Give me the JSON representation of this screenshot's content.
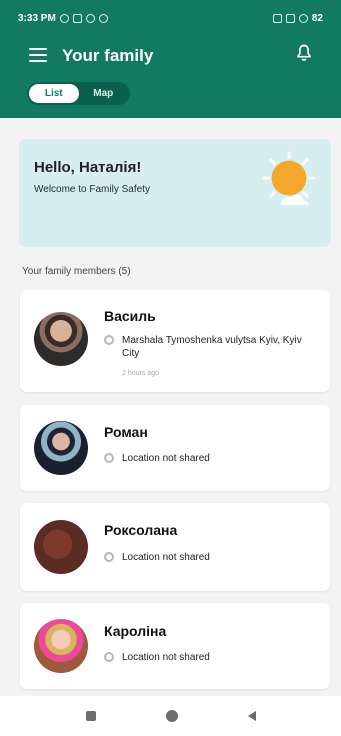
{
  "status": {
    "time": "3:33 PM",
    "battery": "82"
  },
  "header": {
    "title": "Your family",
    "tabs": [
      {
        "label": "List",
        "active": true
      },
      {
        "label": "Map",
        "active": false
      }
    ]
  },
  "hero": {
    "title": "Hello, Наталія!",
    "subtitle": "Welcome to Family Safety"
  },
  "members_section": {
    "label": "Your family members (5)"
  },
  "members": [
    {
      "name": "Василь",
      "location": "Marshala Tymoshenka vulytsa Kyiv, Kyiv City",
      "time": "2 hours ago"
    },
    {
      "name": "Роман",
      "location": "Location not shared"
    },
    {
      "name": "Роксолана",
      "location": "Location not shared"
    },
    {
      "name": "Кароліна",
      "location": "Location not shared"
    }
  ],
  "colors": {
    "header": "#127a62",
    "hero": "#d7eef0",
    "sun": "#f2a82b"
  }
}
